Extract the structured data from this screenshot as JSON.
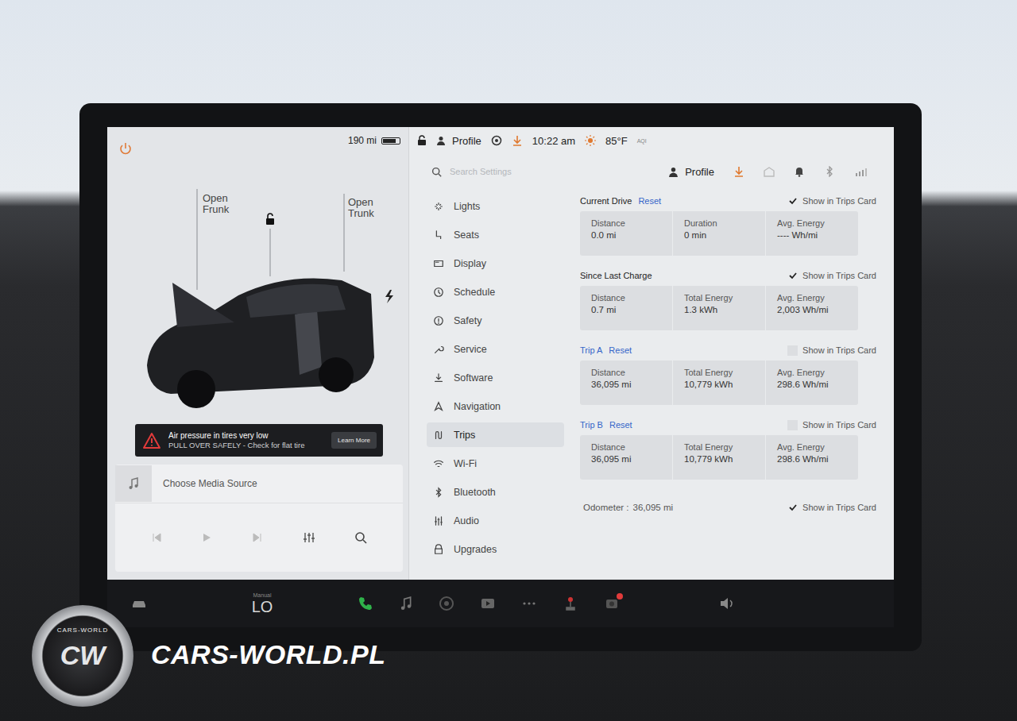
{
  "left_panel": {
    "range": "190 mi",
    "battery_level": 0.8,
    "frunk_label": "Open Frunk",
    "trunk_label": "Open Trunk",
    "alert": {
      "title": "Air pressure in tires very low",
      "message": "PULL OVER SAFELY - Check for flat tire",
      "button": "Learn More"
    },
    "media": {
      "source": "Choose Media Source"
    }
  },
  "status_bar": {
    "profile": "Profile",
    "time": "10:22 am",
    "temperature": "85°F",
    "aqi": "AQI"
  },
  "settings_header": {
    "search_placeholder": "Search Settings",
    "profile": "Profile"
  },
  "menu": [
    {
      "label": "Lights",
      "selected": false
    },
    {
      "label": "Seats",
      "selected": false
    },
    {
      "label": "Display",
      "selected": false
    },
    {
      "label": "Schedule",
      "selected": false
    },
    {
      "label": "Safety",
      "selected": false
    },
    {
      "label": "Service",
      "selected": false
    },
    {
      "label": "Software",
      "selected": false
    },
    {
      "label": "Navigation",
      "selected": false
    },
    {
      "label": "Trips",
      "selected": true
    },
    {
      "label": "Wi-Fi",
      "selected": false
    },
    {
      "label": "Bluetooth",
      "selected": false
    },
    {
      "label": "Audio",
      "selected": false
    },
    {
      "label": "Upgrades",
      "selected": false
    }
  ],
  "trip_sections": [
    {
      "title": "Current Drive",
      "reset": "Reset",
      "title_link": false,
      "show_label": "Show in Trips Card",
      "show_checked": true,
      "stats": [
        {
          "label": "Distance",
          "value": "0.0 mi"
        },
        {
          "label": "Duration",
          "value": "0 min"
        },
        {
          "label": "Avg. Energy",
          "value": "---- Wh/mi"
        }
      ]
    },
    {
      "title": "Since Last Charge",
      "title_link": false,
      "show_label": "Show in Trips Card",
      "show_checked": true,
      "stats": [
        {
          "label": "Distance",
          "value": "0.7 mi"
        },
        {
          "label": "Total Energy",
          "value": "1.3 kWh"
        },
        {
          "label": "Avg. Energy",
          "value": "2,003 Wh/mi"
        }
      ]
    },
    {
      "title": "Trip A",
      "reset": "Reset",
      "title_link": true,
      "show_label": "Show in Trips Card",
      "show_checked": false,
      "stats": [
        {
          "label": "Distance",
          "value": "36,095 mi"
        },
        {
          "label": "Total Energy",
          "value": "10,779 kWh"
        },
        {
          "label": "Avg. Energy",
          "value": "298.6 Wh/mi"
        }
      ]
    },
    {
      "title": "Trip B",
      "reset": "Reset",
      "title_link": true,
      "show_label": "Show in Trips Card",
      "show_checked": false,
      "stats": [
        {
          "label": "Distance",
          "value": "36,095 mi"
        },
        {
          "label": "Total Energy",
          "value": "10,779 kWh"
        },
        {
          "label": "Avg. Energy",
          "value": "298.6 Wh/mi"
        }
      ]
    }
  ],
  "odometer": {
    "label": "Odometer :",
    "value": "36,095 mi",
    "show_label": "Show in Trips Card",
    "show_checked": true
  },
  "bottom_bar": {
    "climate_mode": "Manual",
    "climate_temp": "LO"
  },
  "watermark": {
    "logo": "CW",
    "ring": "CARS-WORLD",
    "site": "CARS-WORLD.PL"
  }
}
